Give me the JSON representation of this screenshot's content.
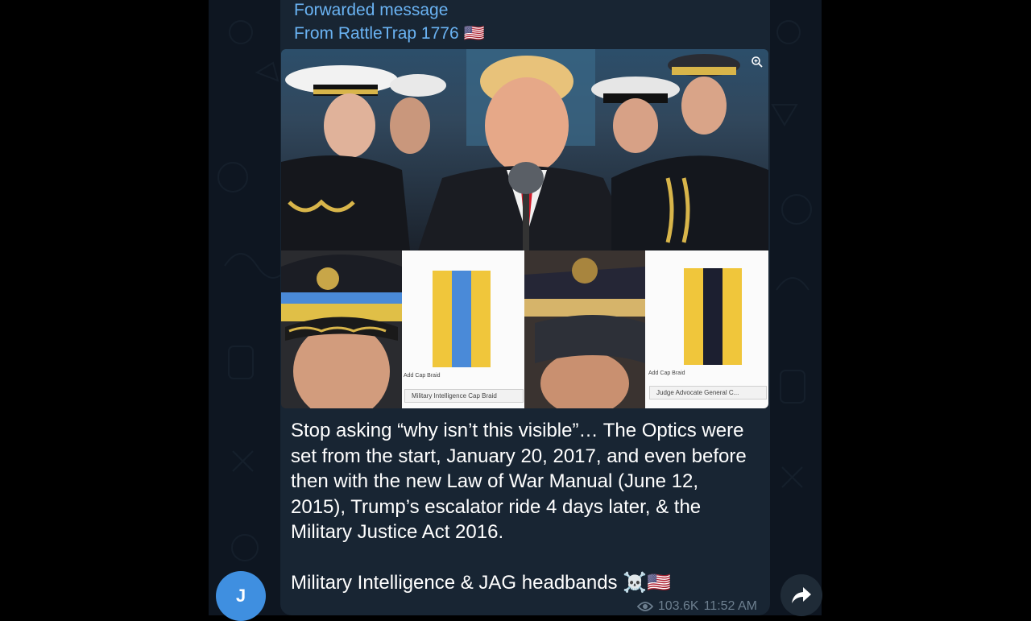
{
  "message": {
    "forward_label": "Forwarded message",
    "forward_from": "From RattleTrap 1776 🇺🇸",
    "text_paragraph_1": "Stop asking “why isn’t this visible”… The Optics were set from the start, January 20, 2017, and even before then with the new Law of War Manual (June 12, 2015), Trump’s escalator ride 4 days later, & the Military Justice Act 2016.",
    "text_paragraph_2": "Military Intelligence & JAG headbands ☠️🇺🇸",
    "views": "103.6K",
    "time": "11:52 AM"
  },
  "image": {
    "panel1_small_label": "Add Cap Braid",
    "panel1_caption": "Military Intelligence Cap Braid",
    "panel2_small_label": "Add Cap Braid",
    "panel2_caption": "Judge Advocate General C..."
  },
  "avatar": {
    "initial": "J",
    "color": "#3f8fe0"
  },
  "colors": {
    "chat_background": "#0e1621",
    "bubble": "#182533",
    "link_blue": "#6ab3f3",
    "meta_gray": "#6d7f8f",
    "braid_gold": "#f0c63b",
    "braid_blue": "#4a8ad8",
    "braid_navy": "#1c1f30"
  },
  "icons": [
    "zoom-icon",
    "eye-icon",
    "share-arrow-icon",
    "us-flag-icon"
  ]
}
